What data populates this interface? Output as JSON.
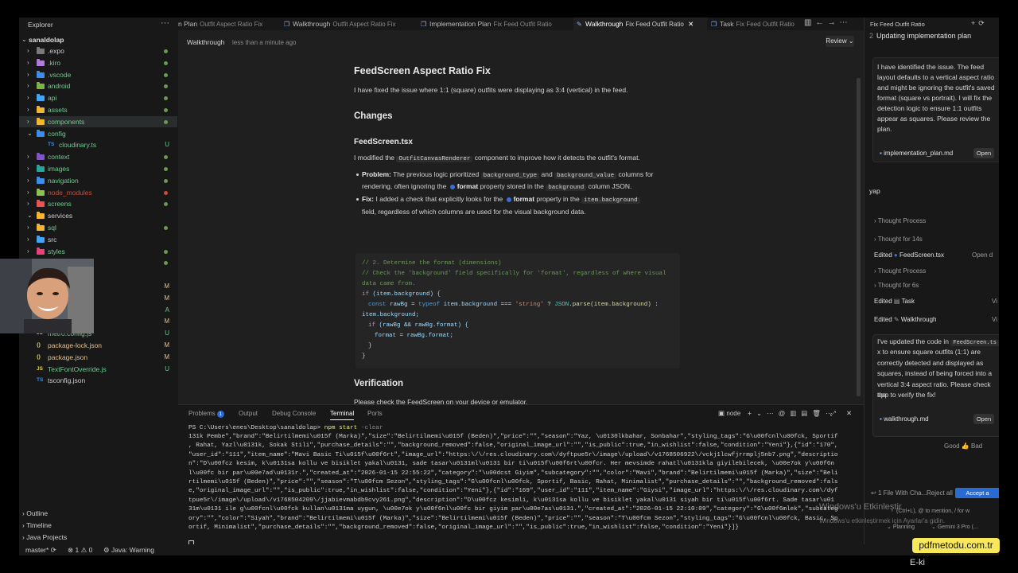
{
  "explorer": {
    "title": "Explorer",
    "root": "sanaldolap",
    "items": [
      {
        "label": ".expo",
        "type": "folder",
        "color": "#7a7a7a",
        "status": "dot",
        "status_color": "#6a9955"
      },
      {
        "label": ".kiro",
        "type": "folder",
        "color": "#b07cd8",
        "status": "dot",
        "status_color": "#6a9955",
        "text_color": "#73c991"
      },
      {
        "label": ".vscode",
        "type": "folder",
        "color": "#3b8eea",
        "status": "dot",
        "status_color": "#6a9955",
        "text_color": "#73c991"
      },
      {
        "label": "android",
        "type": "folder",
        "color": "#7cb342",
        "status": "dot",
        "status_color": "#6a9955",
        "text_color": "#73c991"
      },
      {
        "label": "api",
        "type": "folder",
        "color": "#42a5f5",
        "status": "dot",
        "status_color": "#6a9955",
        "text_color": "#73c991"
      },
      {
        "label": "assets",
        "type": "folder",
        "color": "#f2b632",
        "status": "dot",
        "status_color": "#6a9955",
        "text_color": "#73c991"
      },
      {
        "label": "components",
        "type": "folder",
        "color": "#f2b632",
        "status": "dot",
        "status_color": "#6a9955",
        "text_color": "#73c991",
        "selected": true
      },
      {
        "label": "config",
        "type": "folder-open",
        "color": "#3b8eea",
        "status": "",
        "text_color": "#73c991"
      },
      {
        "label": "cloudinary.ts",
        "type": "ts",
        "status": "U",
        "status_color": "#73c991",
        "text_color": "#73c991",
        "indent": 1
      },
      {
        "label": "context",
        "type": "folder",
        "color": "#7e57c2",
        "status": "dot",
        "status_color": "#6a9955",
        "text_color": "#73c991"
      },
      {
        "label": "images",
        "type": "folder",
        "color": "#26a69a",
        "status": "dot",
        "status_color": "#6a9955",
        "text_color": "#73c991"
      },
      {
        "label": "navigation",
        "type": "folder",
        "color": "#3b8eea",
        "status": "dot",
        "status_color": "#6a9955",
        "text_color": "#73c991"
      },
      {
        "label": "node_modules",
        "type": "folder",
        "color": "#8bc34a",
        "status": "dot",
        "status_color": "#c74e39",
        "text_color": "#c74e39"
      },
      {
        "label": "screens",
        "type": "folder",
        "color": "#ef5350",
        "status": "dot",
        "status_color": "#6a9955",
        "text_color": "#73c991"
      },
      {
        "label": "services",
        "type": "folder-open",
        "color": "#f2b632",
        "status": "",
        "text_color": "#cccccc"
      },
      {
        "label": "sql",
        "type": "folder",
        "color": "#f2b632",
        "status": "dot",
        "status_color": "#6a9955",
        "text_color": "#73c991"
      },
      {
        "label": "src",
        "type": "folder",
        "color": "#42a5f5",
        "status": "",
        "text_color": "#cccccc"
      },
      {
        "label": "styles",
        "type": "folder",
        "color": "#ec407a",
        "status": "dot",
        "status_color": "#6a9955",
        "text_color": "#73c991"
      },
      {
        "label": "",
        "type": "blank",
        "status": "dot",
        "status_color": "#6a9955"
      },
      {
        "label": "",
        "type": "blank",
        "status": ""
      },
      {
        "label": "",
        "type": "blank",
        "status": "M",
        "status_color": "#e2c08d"
      },
      {
        "label": "",
        "type": "blank",
        "status": "M",
        "status_color": "#e2c08d"
      },
      {
        "label": "",
        "type": "blank",
        "status": "A",
        "status_color": "#73c991"
      },
      {
        "label": "index.ts",
        "type": "ts",
        "status": "M",
        "status_color": "#e2c08d",
        "text_color": "#e2c08d"
      },
      {
        "label": "metro.config.js",
        "type": "js",
        "status": "U",
        "status_color": "#73c991",
        "text_color": "#73c991"
      },
      {
        "label": "package-lock.json",
        "type": "json",
        "status": "M",
        "status_color": "#e2c08d",
        "text_color": "#e2c08d"
      },
      {
        "label": "package.json",
        "type": "json",
        "status": "M",
        "status_color": "#e2c08d",
        "text_color": "#e2c08d"
      },
      {
        "label": "TextFontOverride.js",
        "type": "js",
        "status": "U",
        "status_color": "#73c991",
        "text_color": "#73c991"
      },
      {
        "label": "tsconfig.json",
        "type": "tsconfig",
        "status": "",
        "text_color": "#cccccc"
      }
    ],
    "sections": [
      "Outline",
      "Timeline",
      "Java Projects"
    ]
  },
  "tabs": [
    {
      "label": "n Plan",
      "sub": "Outfit Aspect Ratio Fix",
      "active": false
    },
    {
      "label": "Walkthrough",
      "sub": "Outfit Aspect Ratio Fix",
      "active": false
    },
    {
      "label": "Implementation Plan",
      "sub": "Fix Feed Outfit Ratio",
      "active": false
    },
    {
      "label": "Walkthrough",
      "sub": "Fix Feed Outfit Ratio",
      "active": true
    },
    {
      "label": "Task",
      "sub": "Fix Feed Outfit Ratio",
      "active": false
    }
  ],
  "editor": {
    "breadcrumb": "Walkthrough",
    "time": "less than a minute ago",
    "review": "Review ⌄",
    "title": "FeedScreen Aspect Ratio Fix",
    "intro": "I have fixed the issue where 1:1 (square) outfits were displaying as 3:4 (vertical) in the feed.",
    "changes": "Changes",
    "file": "FeedScreen.tsx",
    "modified_pre": "I modified the",
    "modified_code": "OutfitCanvasRenderer",
    "modified_post": "component to improve how it detects the outfit's format.",
    "problem_label": "Problem:",
    "problem_1": "The previous logic prioritized",
    "problem_code1": "background_type",
    "problem_and": "and",
    "problem_code2": "background_value",
    "problem_2": "columns for",
    "problem_3": "rendering, often ignoring the",
    "problem_fmt": "format",
    "problem_4": "property stored in the",
    "problem_code3": "background",
    "problem_5": "column JSON.",
    "fix_label": "Fix:",
    "fix_1": "I added a check that explicitly looks for the",
    "fix_fmt": "format",
    "fix_2": "property in the",
    "fix_code": "item.background",
    "fix_3": "field, regardless of which columns are used for the visual background data.",
    "code": {
      "c1": "// 2. Determine the format (dimensions)",
      "c2": "// Check the 'background' field specifically for 'format', regardless of where visual",
      "c3": "data came from.",
      "l4a": "if",
      "l4b": "(item.background) {",
      "l5a": "const",
      "l5b": "rawBg",
      "l5c": "=",
      "l5d": "typeof",
      "l5e": "item.background",
      "l5f": "===",
      "l5g": "'string'",
      "l5h": "?",
      "l5i": "JSON",
      "l5j": ".parse(item.background) :",
      "l6": "item.background;",
      "l7a": "if",
      "l7b": "(rawBg && rawBg.format) {",
      "l8a": "format",
      "l8b": "= rawBg.format;",
      "l9": "}",
      "l10": "}"
    },
    "verification": "Verification",
    "verify_text": "Please check the FeedScreen on your device or emulator."
  },
  "panel": {
    "tabs": [
      "Problems",
      "Output",
      "Debug Console",
      "Terminal",
      "Ports"
    ],
    "problems_count": "1",
    "node_label": "node",
    "prompt": "PS C:\\Users\\enes\\Desktop\\sanaldolap>",
    "cmd": "npm start",
    "cmd_arg": "-clear",
    "lines": [
      "131k Pembe\",\"brand\":\"Belirtilmemi\\u015f (Marka)\",\"size\":\"Belirtilmemi\\u015f (Beden)\",\"price\":\"\",\"season\":\"Yaz, \\u0130lkbahar, Sonbahar\",\"styling_tags\":\"G\\u00fcnl\\u00fck, Sportif",
      ", Rahat, Yazl\\u0131k, Sokak Stili\",\"purchase_details\":\"\",\"background_removed\":false,\"original_image_url\":\"\",\"is_public\":true,\"in_wishlist\":false,\"condition\":\"Yeni\"},{\"id\":\"170\",",
      "\"user_id\":\"111\",\"item_name\":\"Mavi Basic Ti\\u015f\\u00f6rt\",\"image_url\":\"https:\\/\\/res.cloudinary.com\\/dyftpue5r\\/image\\/upload\\/v1768506922\\/vckj1lcwfjrrmplj5nb7.png\",\"descriptio",
      "n\":\"D\\u00fcz kesim, k\\u0131sa kollu ve bisiklet yakal\\u0131, sade tasar\\u0131ml\\u0131 bir ti\\u015f\\u00f6rt\\u00fcr. Her mevsimde rahatl\\u0131kla giyilebilecek, \\u00e7ok y\\u00f6n",
      "l\\u00fc bir par\\u00e7ad\\u0131r.\",\"created_at\":\"2026-01-15 22:55:22\",\"category\":\"\\u00dcst Giyim\",\"subcategory\":\"\",\"color\":\"Mavi\",\"brand\":\"Belirtilmemi\\u015f (Marka)\",\"size\":\"Beli",
      "rtilmemi\\u015f (Beden)\",\"price\":\"\",\"season\":\"T\\u00fcm Sezon\",\"styling_tags\":\"G\\u00fcnl\\u00fck, Sportif, Basic, Rahat, Minimalist\",\"purchase_details\":\"\",\"background_removed\":fals",
      "e,\"original_image_url\":\"\",\"is_public\":true,\"in_wishlist\":false,\"condition\":\"Yeni\"},{\"id\":\"169\",\"user_id\":\"111\",\"item_name\":\"Giysi\",\"image_url\":\"https:\\/\\/res.cloudinary.com\\/dyf",
      "tpue5r\\/image\\/upload\\/v1768504209\\/jjabievmabdb9cvy261.png\",\"description\":\"D\\u00fcz kesimli, k\\u0131sa kollu ve bisiklet yakal\\u0131 siyah bir ti\\u015f\\u00f6rt. Sade tasar\\u01",
      "31m\\u0131 ile g\\u00fcnl\\u00fck kullan\\u0131ma uygun, \\u00e7ok y\\u00f6nl\\u00fc bir giyim par\\u00e7as\\u0131.\",\"created_at\":\"2026-01-15 22:10:09\",\"category\":\"G\\u00f6mlek\",\"subcateg",
      "ory\":\"\",\"color\":\"Siyah\",\"brand\":\"Belirtilmemi\\u015f (Marka)\",\"size\":\"Belirtilmemi\\u015f (Beden)\",\"price\":\"\",\"season\":\"T\\u00fcm Sezon\",\"styling_tags\":\"G\\u00fcnl\\u00fck, Basic, Sp",
      "ortif, Minimalist\",\"purchase_details\":\"\",\"background_removed\":false,\"original_image_url\":\"\",\"is_public\":true,\"in_wishlist\":false,\"condition\":\"Yeni\"}]}"
    ]
  },
  "chat": {
    "title": "Fix Feed Outfit Ratio",
    "status_num": "2",
    "status": "Updating implementation plan",
    "card1": [
      "I have identified the issue. The feed",
      "layout defaults to a vertical aspect ratio",
      "and might be ignoring the outfit's saved",
      "format (square vs portrait). I will fix the",
      "detection logic to ensure 1:1 outfits",
      "appear as squares. Please review the",
      "plan."
    ],
    "card1_file": "implementation_plan.md",
    "open": "Open",
    "input_text": "yap",
    "thought1": "Thought Process",
    "thought2": "Thought for 14s",
    "edited1_label": "Edited",
    "edited1_file": "FeedScreen.tsx",
    "edited1_right": "Open d",
    "thought3": "Thought Process",
    "thought4": "Thought for 6s",
    "edited2_label": "Edited",
    "edited2_file": "Task",
    "edited2_right": "Vi",
    "edited3_label": "Edited",
    "edited3_file": "Walkthrough",
    "edited3_right": "Vi",
    "card2_pre": "I've updated the code in",
    "card2_code": "FeedScreen.ts",
    "card2": [
      "x  to ensure square outfits (1:1) are",
      "correctly detected and displayed as",
      "squares, instead of being forced into a",
      "vertical 3:4 aspect ratio. Please check the",
      "app to verify the fix!"
    ],
    "card2_file": "walkthrough.md",
    "good": "Good",
    "bad": "Bad",
    "files_changed": "1 File With Cha...",
    "reject": "Reject all",
    "accept": "Accept a",
    "hint": "(Ctrl+L), @ to mention, / for w",
    "planning": "Planning",
    "model": "Gemini 3 Pro (..."
  },
  "statusbar": {
    "branch": "master*",
    "errors": "1",
    "warnings": "0",
    "java": "Java: Warning"
  },
  "overlay": {
    "activate_title": "Windows'u Etkinleştir",
    "activate_sub": "Windows'u etkinleştirmek için Ayarlar'a gidin.",
    "watermark": "pdfmetodu.com.tr",
    "eki": "E-ki"
  }
}
